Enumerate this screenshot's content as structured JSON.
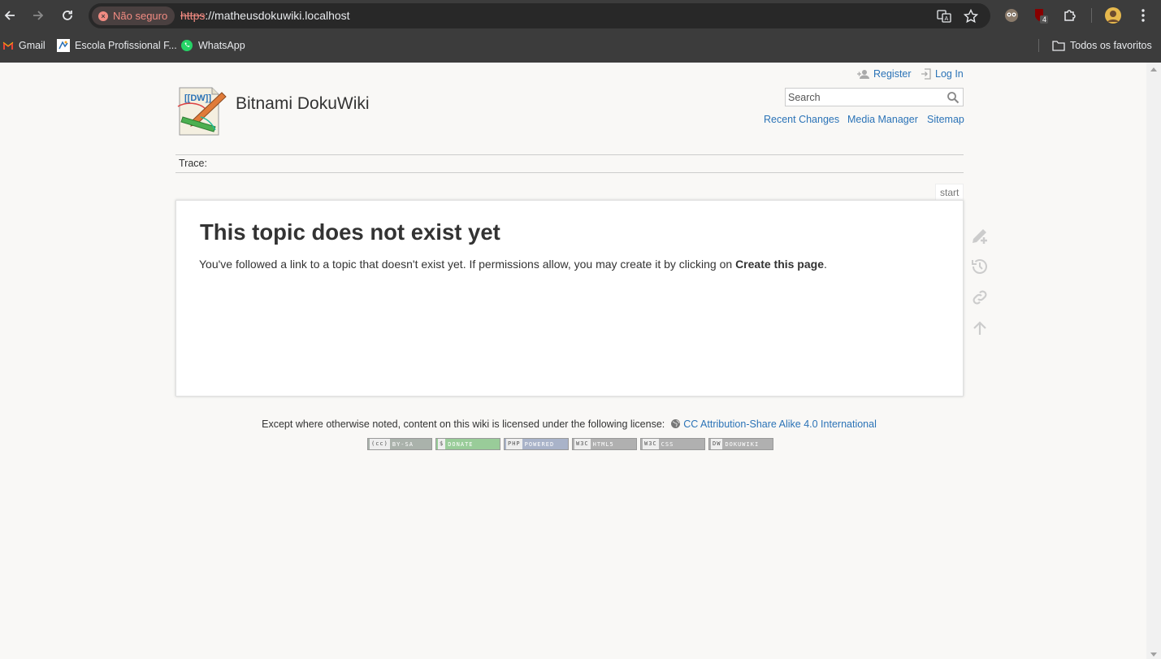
{
  "browser": {
    "security_label": "Não seguro",
    "url_scheme": "https",
    "url_rest": "://matheusdokuwiki.localhost",
    "extension_badge": "4",
    "bookmarks": [
      {
        "label": "Gmail",
        "icon": "gmail-icon"
      },
      {
        "label": "Escola Profissional F...",
        "icon": "school-favicon"
      },
      {
        "label": "WhatsApp",
        "icon": "whatsapp-icon"
      }
    ],
    "all_bookmarks_label": "Todos os favoritos"
  },
  "wiki": {
    "title": "Bitnami DokuWiki",
    "user_tools": {
      "register": "Register",
      "login": "Log In"
    },
    "search_placeholder": "Search",
    "site_tools": {
      "recent": "Recent Changes",
      "media": "Media Manager",
      "sitemap": "Sitemap"
    },
    "trace_label": "Trace:",
    "page_id": "start",
    "heading": "This topic does not exist yet",
    "message_prefix": "You've followed a link to a topic that doesn't exist yet. If permissions allow, you may create it by clicking on ",
    "message_link": "Create this page",
    "message_suffix": ".",
    "license_text": "Except where otherwise noted, content on this wiki is licensed under the following license:",
    "license_link": "CC Attribution-Share Alike 4.0 International",
    "footer_buttons": [
      {
        "tag": "(cc)",
        "text": "BY-SA",
        "color": "#aab2ab"
      },
      {
        "tag": "$",
        "text": "DONATE",
        "color": "#9c9"
      },
      {
        "tag": "PHP",
        "text": "POWERED",
        "color": "#a9b3c9"
      },
      {
        "tag": "W3C",
        "text": "HTML5",
        "color": "#b0b0b0"
      },
      {
        "tag": "W3C",
        "text": "CSS",
        "color": "#b0b0b0"
      },
      {
        "tag": "DW",
        "text": "DOKUWIKI",
        "color": "#b0b0b0"
      }
    ]
  }
}
